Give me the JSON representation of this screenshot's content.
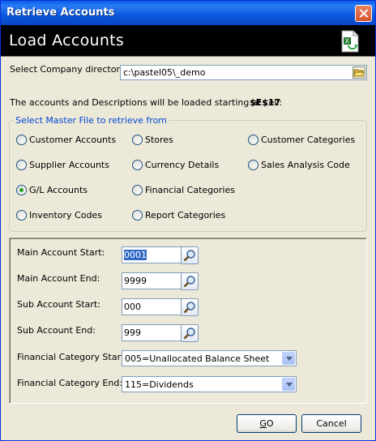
{
  "window": {
    "title": "Retrieve Accounts"
  },
  "header": {
    "title": "Load Accounts",
    "icon": "excel-refresh-icon"
  },
  "company": {
    "label": "Select Company directory:",
    "value": "c:\\pastel05\\_demo"
  },
  "info": {
    "text": "The accounts and Descriptions will be loaded starting at cell:",
    "cell": "$E$17"
  },
  "master_file": {
    "legend": "Select Master File to retrieve from",
    "selected": "G/L Accounts",
    "options": [
      "Customer Accounts",
      "Stores",
      "Customer Categories",
      "Supplier Accounts",
      "Currency Details",
      "Sales Analysis Code",
      "G/L Accounts",
      "Financial Categories",
      "Inventory Codes",
      "Report Categories"
    ]
  },
  "fields": {
    "main_start_label": "Main Account Start:",
    "main_start_value": "0001",
    "main_end_label": "Main Account End:",
    "main_end_value": "9999",
    "sub_start_label": "Sub Account Start:",
    "sub_start_value": "000",
    "sub_end_label": "Sub Account End:",
    "sub_end_value": "999",
    "fin_cat_start_label": "Financial Category Start:",
    "fin_cat_start_value": "005=Unallocated Balance Sheet",
    "fin_cat_end_label": "Financial Category End:",
    "fin_cat_end_value": "115=Dividends"
  },
  "buttons": {
    "go_accel": "G",
    "go_rest": "O",
    "cancel": "Cancel"
  },
  "colors": {
    "title_bar": "#0a5ce6",
    "header_bg": "#000000",
    "dialog_bg": "#ece9d8",
    "legend_text": "#0046d5"
  }
}
